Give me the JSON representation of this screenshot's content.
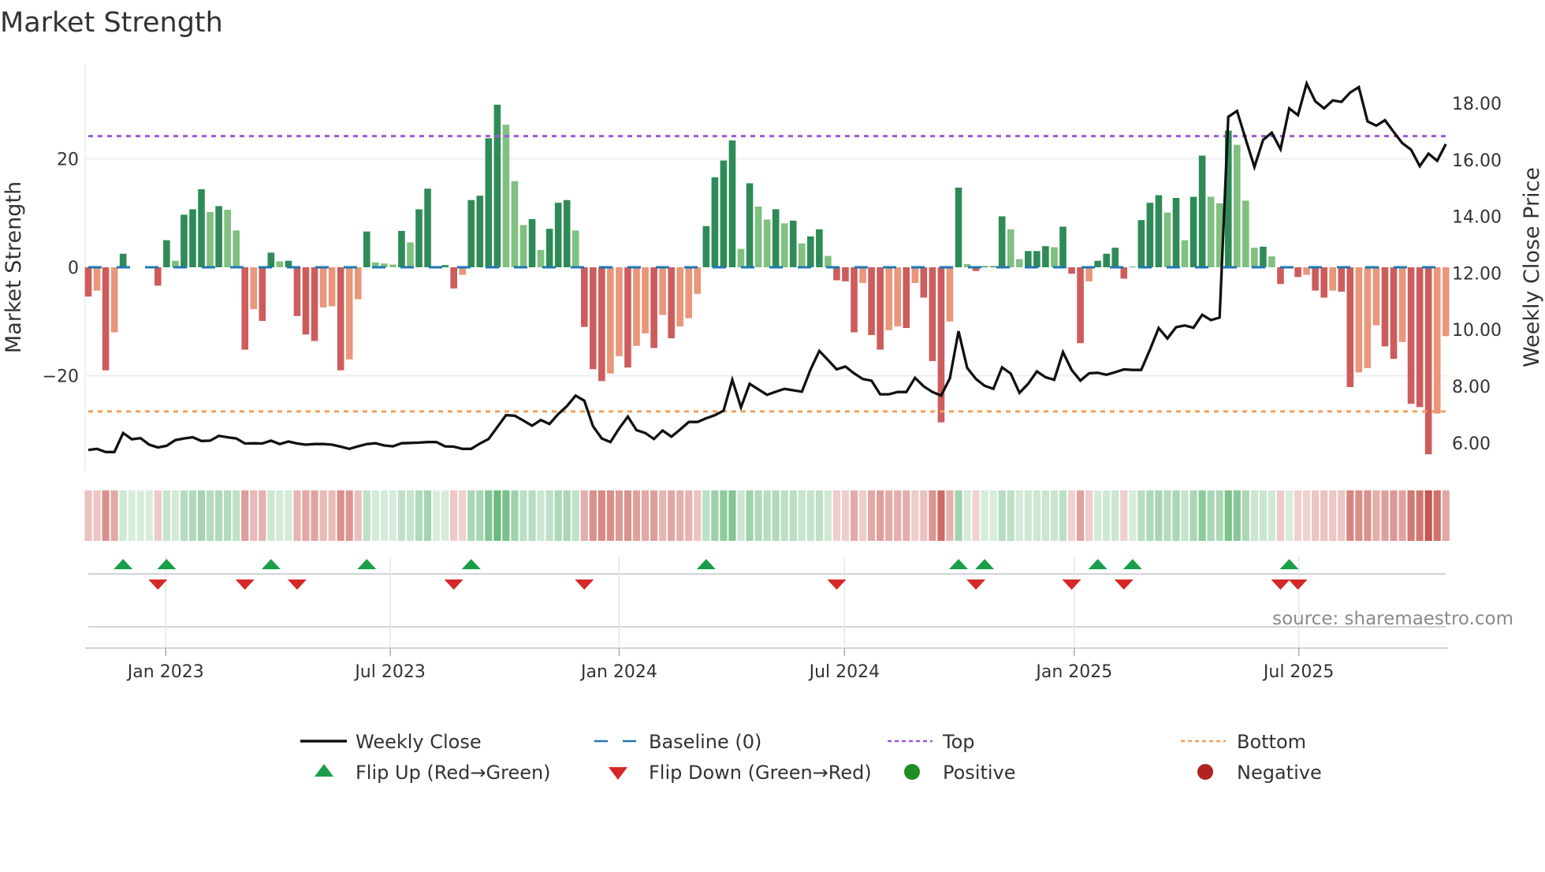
{
  "chart_data": {
    "type": "bar",
    "title": "Market Strength",
    "ylabel": "Market Strength",
    "ylabel_right": "Weekly Close Price",
    "ylim": [
      -37,
      37
    ],
    "ylim_right": [
      5.0,
      19.4
    ],
    "yticks": [
      {
        "value": 20,
        "label": "20"
      },
      {
        "value": 0,
        "label": "0"
      },
      {
        "value": -20,
        "label": "−20"
      }
    ],
    "yticks_right": [
      {
        "value": 18,
        "label": "18.00"
      },
      {
        "value": 16,
        "label": "16.00"
      },
      {
        "value": 14,
        "label": "14.00"
      },
      {
        "value": 12,
        "label": "12.00"
      },
      {
        "value": 10,
        "label": "10.00"
      },
      {
        "value": 8,
        "label": "8.00"
      },
      {
        "value": 6,
        "label": "6.00"
      }
    ],
    "x_unit": "week index",
    "xticks": [
      {
        "week": 8.9,
        "label": "Jan 2023"
      },
      {
        "week": 34.7,
        "label": "Jul 2023"
      },
      {
        "week": 61.0,
        "label": "Jan 2024"
      },
      {
        "week": 86.9,
        "label": "Jul 2024"
      },
      {
        "week": 113.3,
        "label": "Jan 2025"
      },
      {
        "week": 139.1,
        "label": "Jul 2025"
      }
    ],
    "top_level": 24.2,
    "bottom_level": -26.6,
    "grid": true,
    "legend_position": "bottom",
    "strength": [
      -5.4,
      -4.3,
      -19,
      -12,
      2.5,
      0,
      0,
      0,
      -3.4,
      5,
      1.2,
      9.7,
      10.7,
      14.4,
      10.2,
      11.3,
      10.6,
      6.8,
      -15.2,
      -7.7,
      -9.9,
      2.7,
      1.1,
      1.2,
      -9,
      -12.4,
      -13.6,
      -7.4,
      -7.2,
      -19,
      -17,
      -5.9,
      6.6,
      0.9,
      0.7,
      0.5,
      6.7,
      4.6,
      10.7,
      14.5,
      0,
      0.4,
      -3.9,
      -1.4,
      12.4,
      13.2,
      23.8,
      30,
      26.3,
      15.9,
      7.8,
      8.9,
      3.2,
      7.1,
      11.9,
      12.4,
      6.8,
      -11,
      -18.8,
      -21,
      -19.6,
      -16.4,
      -18.5,
      -14.5,
      -12.2,
      -14.9,
      -8.8,
      -13.1,
      -10.9,
      -9.4,
      -4.9,
      7.6,
      16.6,
      19.7,
      23.4,
      3.4,
      15.5,
      11.2,
      8.8,
      10.7,
      8.1,
      8.6,
      4.4,
      5.7,
      7,
      2.1,
      -2.4,
      -2.6,
      -12,
      -2.9,
      -12.5,
      -15.2,
      -11.6,
      -10.9,
      -11.2,
      -2.9,
      -5.6,
      -17.3,
      -28.6,
      -10,
      14.7,
      0.6,
      -0.7,
      0.2,
      0.2,
      9.4,
      7,
      1.5,
      3,
      3,
      3.9,
      3.7,
      7.5,
      -1.2,
      -14,
      -2.6,
      1.2,
      2.5,
      3.6,
      -2.1,
      0.1,
      8.7,
      11.9,
      13.3,
      10.1,
      12.8,
      5,
      13,
      20.6,
      13,
      11.8,
      25.2,
      22.6,
      12.3,
      3.6,
      3.8,
      2,
      -3.1,
      0.2,
      -1.8,
      -1.4,
      -4.3,
      -5.6,
      -4.3,
      -4.5,
      -22.1,
      -19.4,
      -18.6,
      -10.7,
      -14.6,
      -16.9,
      -13.8,
      -25.2,
      -25.8,
      -34.5,
      -27,
      -12.7
    ],
    "weekly_close": [
      5.75,
      5.79,
      5.68,
      5.68,
      6.35,
      6.13,
      6.17,
      5.94,
      5.84,
      5.9,
      6.1,
      6.16,
      6.2,
      6.07,
      6.08,
      6.25,
      6.2,
      6.16,
      5.98,
      5.99,
      5.98,
      6.08,
      5.96,
      6.05,
      5.98,
      5.94,
      5.96,
      5.96,
      5.94,
      5.87,
      5.79,
      5.88,
      5.96,
      5.99,
      5.91,
      5.88,
      5.99,
      6.0,
      6.01,
      6.03,
      6.03,
      5.88,
      5.87,
      5.79,
      5.79,
      5.98,
      6.14,
      6.56,
      6.98,
      6.96,
      6.79,
      6.61,
      6.81,
      6.67,
      7.02,
      7.3,
      7.67,
      7.49,
      6.59,
      6.16,
      6.03,
      6.51,
      6.93,
      6.45,
      6.35,
      6.14,
      6.44,
      6.22,
      6.47,
      6.74,
      6.74,
      6.87,
      6.98,
      7.14,
      8.23,
      7.26,
      8.09,
      7.89,
      7.7,
      7.81,
      7.91,
      7.86,
      7.81,
      8.6,
      9.25,
      8.93,
      8.6,
      8.7,
      8.46,
      8.26,
      8.2,
      7.72,
      7.72,
      7.8,
      7.8,
      8.3,
      8.0,
      7.8,
      7.67,
      8.28,
      9.95,
      8.65,
      8.26,
      8.02,
      7.91,
      8.67,
      8.45,
      7.77,
      8.09,
      8.53,
      8.32,
      8.23,
      9.21,
      8.58,
      8.2,
      8.46,
      8.48,
      8.41,
      8.5,
      8.6,
      8.58,
      8.58,
      9.3,
      10.06,
      9.69,
      10.09,
      10.15,
      10.07,
      10.53,
      10.34,
      10.43,
      17.52,
      17.73,
      16.73,
      15.75,
      16.71,
      16.96,
      16.38,
      17.82,
      17.58,
      18.7,
      18.07,
      17.82,
      18.1,
      18.05,
      18.38,
      18.57,
      17.36,
      17.21,
      17.4,
      16.99,
      16.59,
      16.36,
      15.78,
      16.22,
      15.97,
      16.56
    ],
    "flip_up_weeks": [
      4,
      9,
      21,
      32,
      44,
      71,
      100,
      103,
      116,
      120,
      138
    ],
    "flip_down_weeks": [
      8,
      18,
      24,
      42,
      57,
      86,
      102,
      113,
      119,
      137,
      139
    ],
    "legend": [
      {
        "label": "Weekly Close",
        "kind": "line"
      },
      {
        "label": "Baseline (0)",
        "kind": "dash"
      },
      {
        "label": "Top",
        "kind": "dot"
      },
      {
        "label": "Bottom",
        "kind": "dot"
      },
      {
        "label": "Flip Up (Red→Green)",
        "kind": "tri-up"
      },
      {
        "label": "Flip Down (Green→Red)",
        "kind": "tri-down"
      },
      {
        "label": "Positive",
        "kind": "circle"
      },
      {
        "label": "Negative",
        "kind": "circle"
      }
    ],
    "annotation": "source: sharemaestro.com"
  },
  "colors": {
    "pos_strong": "#2e8b57",
    "pos_weak": "#80c080",
    "neg_strong": "#cd5c5c",
    "neg_weak": "#e9967a",
    "close": "#111111",
    "baseline": "#1f77b4",
    "top": "#9b59d9",
    "bottom": "#f0a060",
    "flip_up": "#1a9e4a",
    "flip_down": "#d62728",
    "positive": "#228b22",
    "negative": "#b22222"
  }
}
